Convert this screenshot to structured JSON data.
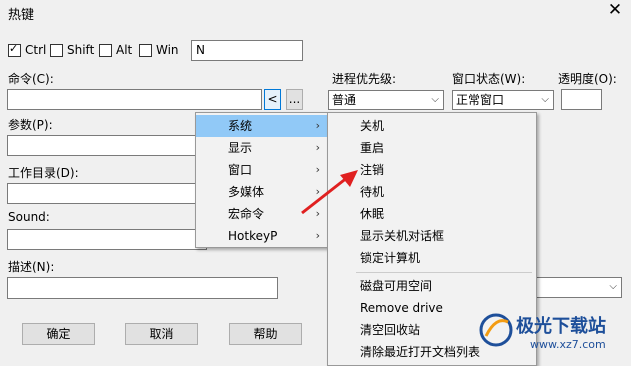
{
  "window": {
    "title": "热键",
    "close": "✕"
  },
  "modifiers": [
    {
      "label": "Ctrl",
      "checked": true
    },
    {
      "label": "Shift",
      "checked": false
    },
    {
      "label": "Alt",
      "checked": false
    },
    {
      "label": "Win",
      "checked": false
    }
  ],
  "key_value": "N",
  "command": {
    "label": "命令(C):",
    "value": "",
    "arrow_btn": "<",
    "browse_btn": "..."
  },
  "priority": {
    "label": "进程优先级:",
    "value": "普通"
  },
  "window_state": {
    "label": "窗口状态(W):",
    "value": "正常窗口"
  },
  "transparency": {
    "label": "透明度(O):",
    "value": ""
  },
  "params": {
    "label": "参数(P):"
  },
  "workdir": {
    "label": "工作目录(D):"
  },
  "sound": {
    "label": "Sound:"
  },
  "desc": {
    "label": "描述(N):"
  },
  "buttons": {
    "ok": "确定",
    "cancel": "取消",
    "help": "帮助"
  },
  "menu": {
    "items": [
      {
        "label": "系统",
        "has_sub": true,
        "highlighted": true
      },
      {
        "label": "显示",
        "has_sub": true
      },
      {
        "label": "窗口",
        "has_sub": true
      },
      {
        "label": "多媒体",
        "has_sub": true
      },
      {
        "label": "宏命令",
        "has_sub": true
      },
      {
        "label": "HotkeyP",
        "has_sub": true
      }
    ],
    "submenu_arrow": "›"
  },
  "submenu": {
    "group1": [
      "关机",
      "重启",
      "注销",
      "待机",
      "休眠",
      "显示关机对话框",
      "锁定计算机"
    ],
    "group2": [
      "磁盘可用空间",
      "Remove drive",
      "清空回收站",
      "清除最近打开文档列表"
    ]
  },
  "watermark": {
    "brand": "极光下载站",
    "url": "www.xz7.com"
  },
  "colors": {
    "highlight": "#91c9f7",
    "arrow_red": "#e02020",
    "watermark": "#1e4f9a"
  }
}
